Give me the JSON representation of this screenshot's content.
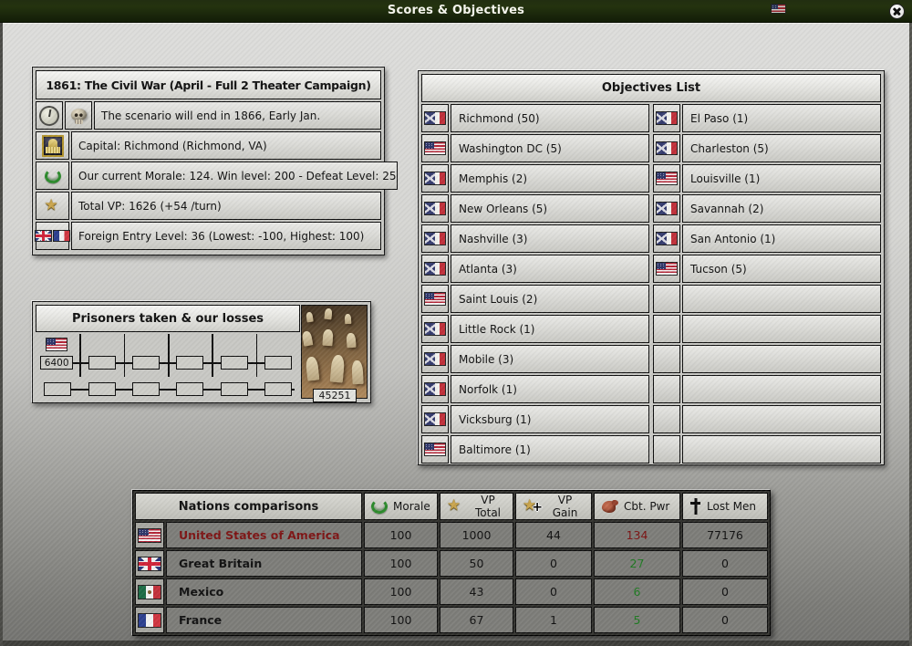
{
  "title_bar": {
    "title": "Scores & Objectives"
  },
  "scenario_panel": {
    "title": "1861: The Civil War (April - Full 2 Theater Campaign)",
    "rows": [
      {
        "icon_cells": [
          [
            "clock-icon"
          ],
          [
            "skull-icon"
          ]
        ],
        "text": "The scenario will end in 1866, Early Jan."
      },
      {
        "icon_cells": [
          [
            "capitol-icon"
          ]
        ],
        "text": "Capital: Richmond (Richmond, VA)"
      },
      {
        "icon_cells": [
          [
            "laurel-icon"
          ]
        ],
        "text": "Our current Morale: 124. Win level: 200 - Defeat Level: 25"
      },
      {
        "icon_cells": [
          [
            "star-icon"
          ]
        ],
        "text": "Total VP: 1626 (+54 /turn)"
      },
      {
        "icon_cells": [
          [
            "uk-flag-icon",
            "france-flag-icon"
          ]
        ],
        "text": "Foreign Entry Level: 36  (Lowest: -100, Highest: 100)"
      }
    ]
  },
  "prisoners_panel": {
    "title": "Prisoners taken & our losses",
    "flag": "usa",
    "prisoners_value": "6400",
    "losses_value": "45251",
    "columns": 6
  },
  "objectives_panel": {
    "title": "Objectives List",
    "left": [
      {
        "flag": "csa",
        "label": "Richmond (50)"
      },
      {
        "flag": "usa",
        "label": "Washington DC (5)"
      },
      {
        "flag": "csa",
        "label": "Memphis (2)"
      },
      {
        "flag": "csa",
        "label": "New Orleans (5)"
      },
      {
        "flag": "csa",
        "label": "Nashville (3)"
      },
      {
        "flag": "csa",
        "label": "Atlanta (3)"
      },
      {
        "flag": "usa",
        "label": "Saint Louis (2)"
      },
      {
        "flag": "csa",
        "label": "Little Rock (1)"
      },
      {
        "flag": "csa",
        "label": "Mobile (3)"
      },
      {
        "flag": "csa",
        "label": "Norfolk (1)"
      },
      {
        "flag": "csa",
        "label": "Vicksburg (1)"
      },
      {
        "flag": "usa",
        "label": "Baltimore (1)"
      }
    ],
    "right": [
      {
        "flag": "csa",
        "label": "El Paso (1)"
      },
      {
        "flag": "csa",
        "label": "Charleston (5)"
      },
      {
        "flag": "usa",
        "label": "Louisville (1)"
      },
      {
        "flag": "csa",
        "label": "Savannah (2)"
      },
      {
        "flag": "csa",
        "label": "San Antonio (1)"
      },
      {
        "flag": "usa",
        "label": "Tucson (5)"
      },
      {
        "flag": "",
        "label": ""
      },
      {
        "flag": "",
        "label": ""
      },
      {
        "flag": "",
        "label": ""
      },
      {
        "flag": "",
        "label": ""
      },
      {
        "flag": "",
        "label": ""
      },
      {
        "flag": "",
        "label": ""
      }
    ]
  },
  "nations_table": {
    "title": "Nations comparisons",
    "columns": [
      {
        "icon": "laurel-icon",
        "label": "Morale"
      },
      {
        "icon": "star-icon",
        "label": "VP Total"
      },
      {
        "icon": "star-plus-icon",
        "label": "VP Gain"
      },
      {
        "icon": "bicep-icon",
        "label": "Cbt. Pwr"
      },
      {
        "icon": "cross-icon",
        "label": "Lost Men"
      }
    ],
    "rows": [
      {
        "flag": "usa",
        "name": "United States of America",
        "name_style": "red",
        "values": [
          {
            "v": "100"
          },
          {
            "v": "1000"
          },
          {
            "v": "44"
          },
          {
            "v": "134",
            "style": "red"
          },
          {
            "v": "77176"
          }
        ]
      },
      {
        "flag": "uk",
        "name": "Great Britain",
        "name_style": "",
        "values": [
          {
            "v": "100"
          },
          {
            "v": "50"
          },
          {
            "v": "0"
          },
          {
            "v": "27",
            "style": "green"
          },
          {
            "v": "0"
          }
        ]
      },
      {
        "flag": "mexico",
        "name": "Mexico",
        "name_style": "",
        "values": [
          {
            "v": "100"
          },
          {
            "v": "43"
          },
          {
            "v": "0"
          },
          {
            "v": "6",
            "style": "green"
          },
          {
            "v": "0"
          }
        ]
      },
      {
        "flag": "france",
        "name": "France",
        "name_style": "",
        "values": [
          {
            "v": "100"
          },
          {
            "v": "67"
          },
          {
            "v": "1"
          },
          {
            "v": "5",
            "style": "green"
          },
          {
            "v": "0"
          }
        ]
      }
    ]
  },
  "colors": {
    "titlebar_green": "#1d2a0c",
    "negative_red": "#7d1414",
    "positive_green": "#1f7a22"
  }
}
